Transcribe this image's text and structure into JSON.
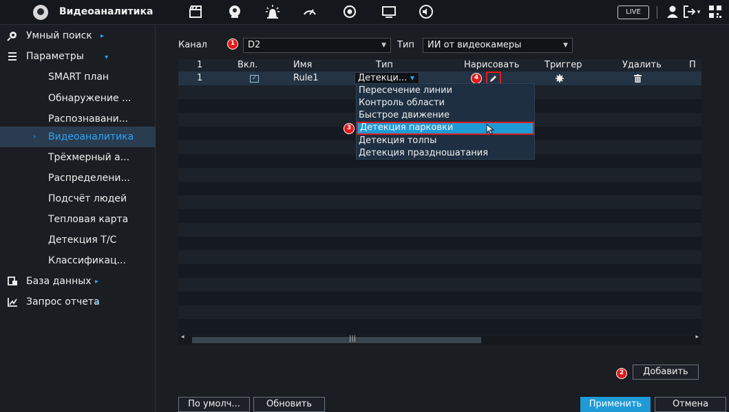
{
  "app": {
    "title": "Видеоаналитика",
    "live_label": "LIVE"
  },
  "sidebar": {
    "items": [
      {
        "label": "Умный поиск"
      },
      {
        "label": "Параметры"
      },
      {
        "label": "SMART план"
      },
      {
        "label": "Обнаружение ..."
      },
      {
        "label": "Распознавани..."
      },
      {
        "label": "Видеоаналитика"
      },
      {
        "label": "Трёхмерный а..."
      },
      {
        "label": "Распределени..."
      },
      {
        "label": "Подсчёт людей"
      },
      {
        "label": "Тепловая карта"
      },
      {
        "label": "Детекция Т/С"
      },
      {
        "label": "Классификац..."
      },
      {
        "label": "База данных"
      },
      {
        "label": "Запрос отчета"
      }
    ]
  },
  "form": {
    "channel_label": "Канал",
    "channel_value": "D2",
    "type_label": "Тип",
    "type_value": "ИИ от видеокамеры"
  },
  "table": {
    "headers": [
      "1",
      "Вкл.",
      "Имя",
      "Тип",
      "Нарисовать",
      "Триггер",
      "Удалить",
      "П"
    ],
    "rows": [
      {
        "num": "1",
        "enabled": true,
        "name": "Rule1",
        "type": "Детекци..."
      }
    ]
  },
  "dropdown": {
    "options": [
      "Пересечение линии",
      "Контроль области",
      "Быстрое движение",
      "Детекция парковки",
      "Детекция толпы",
      "Детекция праздношатания"
    ],
    "highlighted": "Детекция парковки"
  },
  "badges": {
    "b1": "1",
    "b2": "2",
    "b3": "3",
    "b4": "4"
  },
  "buttons": {
    "add": "Добавить",
    "default": "По умолч...",
    "refresh": "Обновить",
    "apply": "Применить",
    "cancel": "Отмена"
  },
  "colors": {
    "accent": "#1e9bd7",
    "highlight_border": "#e01b1b",
    "active_text": "#2ba5f7"
  }
}
